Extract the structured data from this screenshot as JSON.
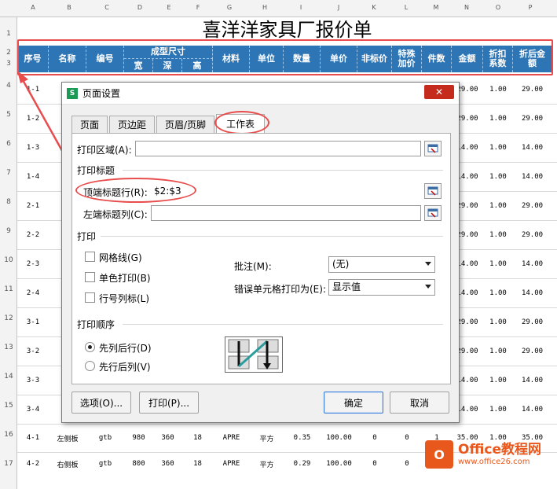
{
  "sheet": {
    "title": "喜洋洋家具厂报价单",
    "column_letters": [
      "A",
      "B",
      "C",
      "D",
      "E",
      "F",
      "G",
      "H",
      "I",
      "J",
      "K",
      "L",
      "M",
      "N",
      "O",
      "P"
    ],
    "row_numbers": [
      "1",
      "2",
      "3",
      "4",
      "5",
      "6",
      "7",
      "8",
      "9",
      "10",
      "11",
      "12",
      "13",
      "14",
      "15",
      "16",
      "17"
    ],
    "header": {
      "seq": "序号",
      "name": "名称",
      "code": "编号",
      "size": "成型尺寸",
      "width": "宽",
      "depth": "深",
      "height": "高",
      "material": "材料",
      "unit": "单位",
      "qty": "数量",
      "price": "单价",
      "nonstd": "非标价",
      "special": "特殊加价",
      "pieces": "件数",
      "amount": "金额",
      "discount": "折扣系数",
      "after": "折后金额"
    },
    "left_rows": [
      "1-1",
      "1-2",
      "1-3",
      "1-4",
      "2-1",
      "2-2",
      "2-3",
      "2-4",
      "3-1",
      "3-2",
      "3-3",
      "3-4"
    ],
    "right_vals": [
      {
        "n": "29.00",
        "o": "1.00",
        "p": "29.00"
      },
      {
        "n": "29.00",
        "o": "1.00",
        "p": "29.00"
      },
      {
        "n": "14.00",
        "o": "1.00",
        "p": "14.00"
      },
      {
        "n": "14.00",
        "o": "1.00",
        "p": "14.00"
      },
      {
        "n": "29.00",
        "o": "1.00",
        "p": "29.00"
      },
      {
        "n": "29.00",
        "o": "1.00",
        "p": "29.00"
      },
      {
        "n": "14.00",
        "o": "1.00",
        "p": "14.00"
      },
      {
        "n": "14.00",
        "o": "1.00",
        "p": "14.00"
      },
      {
        "n": "29.00",
        "o": "1.00",
        "p": "29.00"
      },
      {
        "n": "29.00",
        "o": "1.00",
        "p": "29.00"
      },
      {
        "n": "14.00",
        "o": "1.00",
        "p": "14.00"
      },
      {
        "n": "14.00",
        "o": "1.00",
        "p": "14.00"
      }
    ],
    "row16": [
      "4-1",
      "左侧板",
      "gtb",
      "980",
      "360",
      "18",
      "APRE",
      "平方",
      "0.35",
      "100.00",
      "0",
      "0",
      "1",
      "35.00",
      "1.00",
      "35.00"
    ],
    "row17": [
      "4-2",
      "右侧板",
      "gtb",
      "800",
      "360",
      "18",
      "APRE",
      "平方",
      "0.29",
      "100.00",
      "0",
      "0",
      "1",
      "",
      "",
      ""
    ]
  },
  "dialog": {
    "icon_letter": "S",
    "title": "页面设置",
    "close": "✕",
    "tabs": [
      "页面",
      "页边距",
      "页眉/页脚",
      "工作表"
    ],
    "print_area_label": "打印区域(A):",
    "print_titles_label": "打印标题",
    "title_rows_label": "顶端标题行(R):",
    "title_rows_value": "$2:$3",
    "title_cols_label": "左端标题列(C):",
    "print_section": "打印",
    "gridlines": "网格线(G)",
    "mono": "单色打印(B)",
    "rowcol_headers": "行号列标(L)",
    "comments_label": "批注(M):",
    "comments_value": "(无)",
    "errors_label": "错误单元格打印为(E):",
    "errors_value": "显示值",
    "order_section": "打印顺序",
    "order_down_then_over": "先列后行(D)",
    "order_over_then_down": "先行后列(V)",
    "options_btn": "选项(O)...",
    "print_btn": "打印(P)...",
    "ok_btn": "确定",
    "cancel_btn": "取消"
  },
  "watermark": {
    "logo": "O",
    "main": "Office教程网",
    "sub": "www.office26.com"
  },
  "colors": {
    "header_blue": "#2e75b6",
    "annotation_red": "#e84c4c",
    "brand_orange": "#e8581c"
  }
}
